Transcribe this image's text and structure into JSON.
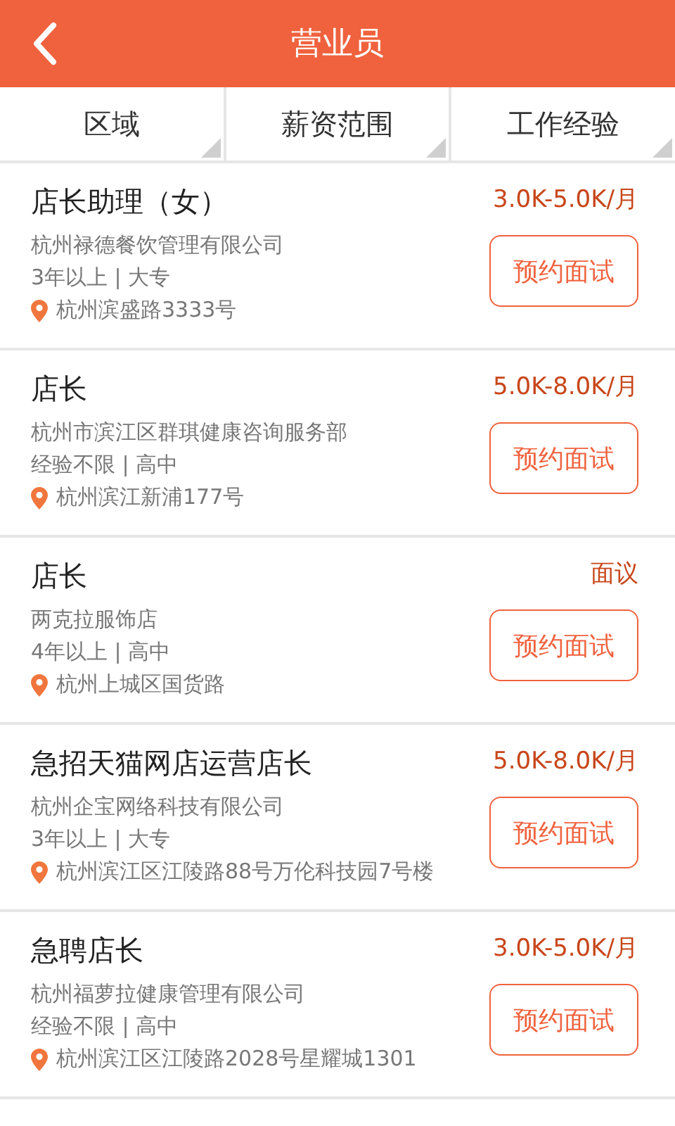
{
  "header": {
    "title": "营业员"
  },
  "filters": [
    {
      "label": "区域"
    },
    {
      "label": "薪资范围"
    },
    {
      "label": "工作经验"
    }
  ],
  "jobs": [
    {
      "title": "店长助理（女）",
      "company": "杭州禄德餐饮管理有限公司",
      "requirements": "3年以上 | 大专",
      "address": "杭州滨盛路3333号",
      "salary": "3.0K-5.0K/月",
      "button": "预约面试"
    },
    {
      "title": "店长",
      "company": "杭州市滨江区群琪健康咨询服务部",
      "requirements": "经验不限 | 高中",
      "address": "杭州滨江新浦177号",
      "salary": "5.0K-8.0K/月",
      "button": "预约面试"
    },
    {
      "title": "店长",
      "company": "两克拉服饰店",
      "requirements": "4年以上 | 高中",
      "address": "杭州上城区国货路",
      "salary": "面议",
      "button": "预约面试"
    },
    {
      "title": "急招天猫网店运营店长",
      "company": "杭州企宝网络科技有限公司",
      "requirements": "3年以上 | 大专",
      "address": "杭州滨江区江陵路88号万伦科技园7号楼",
      "salary": "5.0K-8.0K/月",
      "button": "预约面试"
    },
    {
      "title": "急聘店长",
      "company": "杭州福萝拉健康管理有限公司",
      "requirements": "经验不限 | 高中",
      "address": "杭州滨江区江陵路2028号星耀城1301",
      "salary": "3.0K-5.0K/月",
      "button": "预约面试"
    }
  ]
}
